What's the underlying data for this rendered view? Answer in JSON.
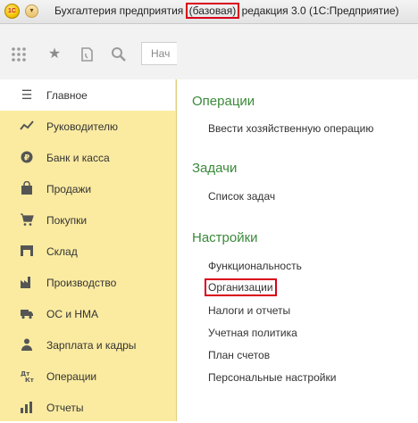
{
  "window": {
    "title_prefix": "Бухгалтерия предприятия ",
    "title_highlight": "(базовая)",
    "title_suffix": " редакция 3.0  (1С:Предприятие)",
    "logo_text": "1С"
  },
  "toolbar": {
    "search_text": "Нач"
  },
  "sidebar": {
    "items": [
      {
        "label": "Главное",
        "icon": "menu-lines-icon"
      },
      {
        "label": "Руководителю",
        "icon": "trend-icon"
      },
      {
        "label": "Банк и касса",
        "icon": "bank-icon"
      },
      {
        "label": "Продажи",
        "icon": "bag-icon"
      },
      {
        "label": "Покупки",
        "icon": "cart-icon"
      },
      {
        "label": "Склад",
        "icon": "warehouse-icon"
      },
      {
        "label": "Производство",
        "icon": "factory-icon"
      },
      {
        "label": "ОС и НМА",
        "icon": "truck-icon"
      },
      {
        "label": "Зарплата и кадры",
        "icon": "people-icon"
      },
      {
        "label": "Операции",
        "icon": "operations-icon"
      },
      {
        "label": "Отчеты",
        "icon": "chart-icon"
      }
    ]
  },
  "main": {
    "sections": [
      {
        "title": "Операции",
        "links": [
          "Ввести хозяйственную операцию"
        ]
      },
      {
        "title": "Задачи",
        "links": [
          "Список задач"
        ]
      },
      {
        "title": "Настройки",
        "links": [
          "Функциональность",
          "Организации",
          "Налоги и отчеты",
          "Учетная политика",
          "План счетов",
          "Персональные настройки"
        ]
      }
    ]
  }
}
